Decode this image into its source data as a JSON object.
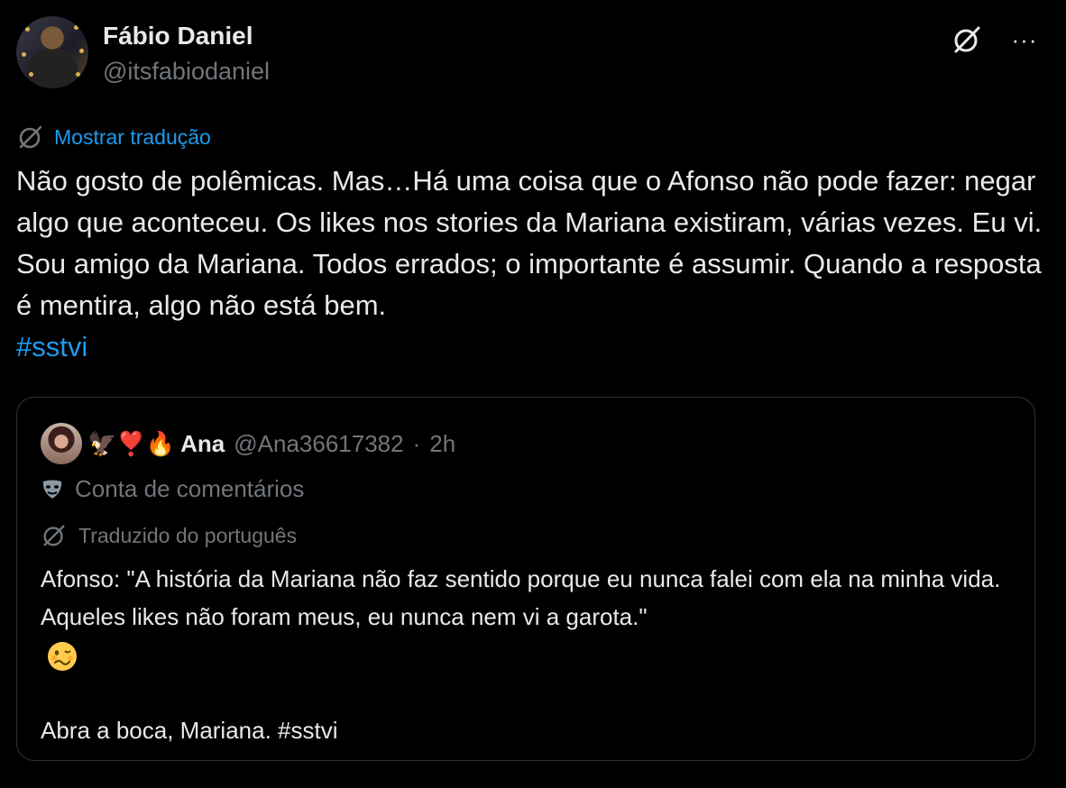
{
  "author": {
    "name": "Fábio Daniel",
    "handle": "@itsfabiodaniel"
  },
  "actions": {
    "grok_icon": "grok-icon",
    "more": "···"
  },
  "tweet": {
    "translate_label": "Mostrar tradução",
    "text": "Não gosto de polêmicas. Mas…Há uma coisa que o Afonso não pode fazer: negar algo que aconteceu. Os likes nos stories da Mariana existiram, várias vezes. Eu vi. Sou amigo da Mariana. Todos errados; o importante é assumir. Quando a resposta é mentira, algo não está bem.",
    "hashtag": "#sstvi"
  },
  "quote": {
    "name_emojis": "🦅❣️🔥",
    "name": "Ana",
    "handle": "@Ana36617382",
    "separator": "·",
    "time": "2h",
    "label": "Conta de comentários",
    "translated_label": "Traduzido do português",
    "line1": "Afonso: \"A história da Mariana não faz sentido porque eu nunca falei com ela na minha vida. Aqueles likes não foram meus, eu nunca nem vi a garota.\"",
    "line2": "Abra a boca, Mariana. #sstvi",
    "emoji_icon": "woozy-face-icon"
  },
  "colors": {
    "background": "#000000",
    "text": "#e7e9ea",
    "muted": "#71767b",
    "link": "#1d9bf0",
    "border": "#2f3336"
  }
}
